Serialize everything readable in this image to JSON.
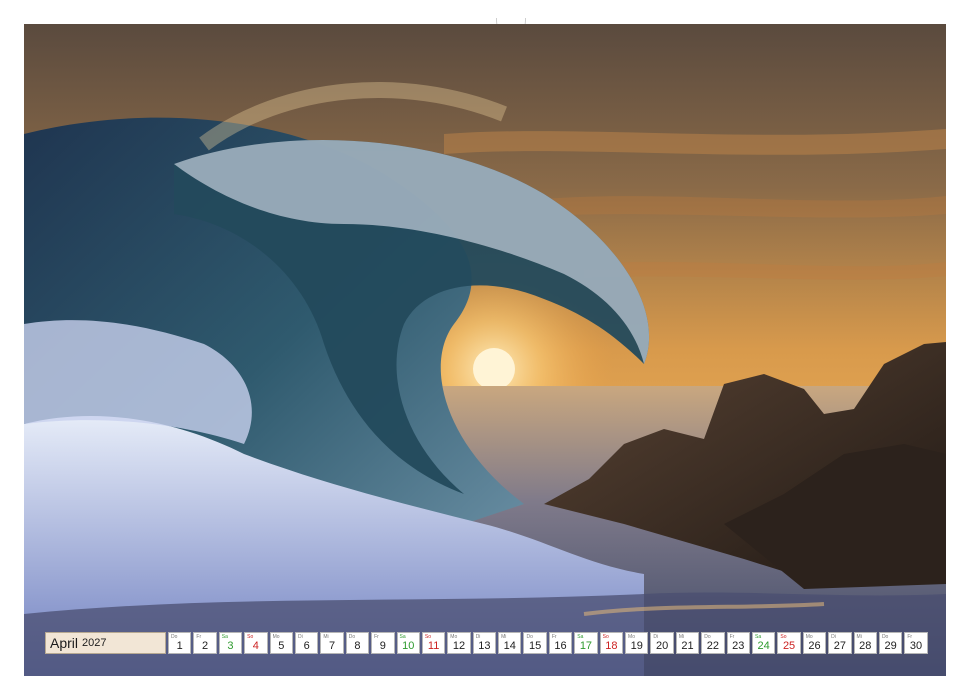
{
  "calendar": {
    "month": "April",
    "year": "2027",
    "days": [
      {
        "dow": "Do",
        "num": "1",
        "kind": "weekday"
      },
      {
        "dow": "Fr",
        "num": "2",
        "kind": "weekday"
      },
      {
        "dow": "Sa",
        "num": "3",
        "kind": "sat"
      },
      {
        "dow": "So",
        "num": "4",
        "kind": "sun"
      },
      {
        "dow": "Mo",
        "num": "5",
        "kind": "weekday"
      },
      {
        "dow": "Di",
        "num": "6",
        "kind": "weekday"
      },
      {
        "dow": "Mi",
        "num": "7",
        "kind": "weekday"
      },
      {
        "dow": "Do",
        "num": "8",
        "kind": "weekday"
      },
      {
        "dow": "Fr",
        "num": "9",
        "kind": "weekday"
      },
      {
        "dow": "Sa",
        "num": "10",
        "kind": "sat"
      },
      {
        "dow": "So",
        "num": "11",
        "kind": "sun"
      },
      {
        "dow": "Mo",
        "num": "12",
        "kind": "weekday"
      },
      {
        "dow": "Di",
        "num": "13",
        "kind": "weekday"
      },
      {
        "dow": "Mi",
        "num": "14",
        "kind": "weekday"
      },
      {
        "dow": "Do",
        "num": "15",
        "kind": "weekday"
      },
      {
        "dow": "Fr",
        "num": "16",
        "kind": "weekday"
      },
      {
        "dow": "Sa",
        "num": "17",
        "kind": "sat"
      },
      {
        "dow": "So",
        "num": "18",
        "kind": "sun"
      },
      {
        "dow": "Mo",
        "num": "19",
        "kind": "weekday"
      },
      {
        "dow": "Di",
        "num": "20",
        "kind": "weekday"
      },
      {
        "dow": "Mi",
        "num": "21",
        "kind": "weekday"
      },
      {
        "dow": "Do",
        "num": "22",
        "kind": "weekday"
      },
      {
        "dow": "Fr",
        "num": "23",
        "kind": "weekday"
      },
      {
        "dow": "Sa",
        "num": "24",
        "kind": "sat"
      },
      {
        "dow": "So",
        "num": "25",
        "kind": "sun"
      },
      {
        "dow": "Mo",
        "num": "26",
        "kind": "weekday"
      },
      {
        "dow": "Di",
        "num": "27",
        "kind": "weekday"
      },
      {
        "dow": "Mi",
        "num": "28",
        "kind": "weekday"
      },
      {
        "dow": "Do",
        "num": "29",
        "kind": "weekday"
      },
      {
        "dow": "Fr",
        "num": "30",
        "kind": "weekday"
      }
    ]
  },
  "colors": {
    "saturday": "#2e9a2e",
    "sunday": "#cc2222",
    "month_box": "#f2e6d6"
  }
}
